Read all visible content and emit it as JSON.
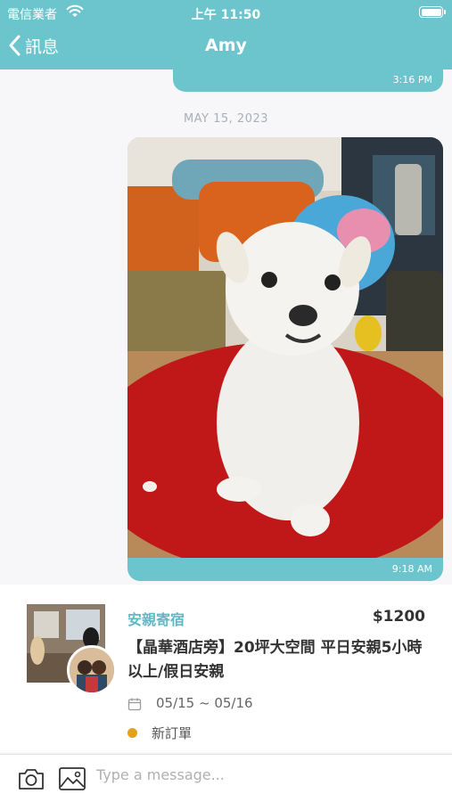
{
  "status_bar": {
    "carrier": "電信業者",
    "time": "上午 11:50"
  },
  "nav": {
    "back_label": "訊息",
    "title": "Amy"
  },
  "messages": {
    "previous_time": "3:16 PM",
    "date_separator": "MAY 15, 2023",
    "image_time": "9:18 AM"
  },
  "order": {
    "service_type": "安親寄宿",
    "price": "$1200",
    "title": "【晶華酒店旁】20坪大空間 平日安親5小時以上/假日安親",
    "date_range": "05/15 ~ 05/16",
    "status": "新訂單",
    "status_color": "#e3a21a"
  },
  "composer": {
    "placeholder": "Type a message..."
  },
  "theme": {
    "accent": "#6cc4cc"
  }
}
